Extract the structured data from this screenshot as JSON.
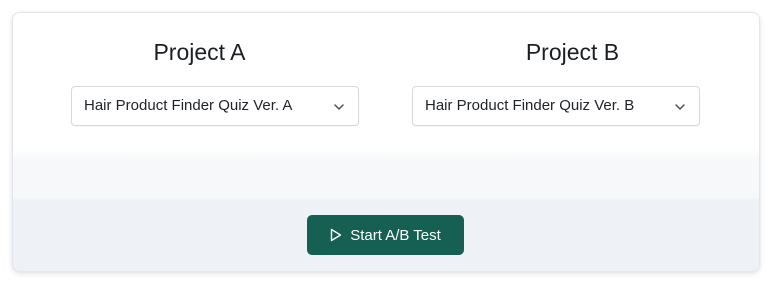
{
  "projects": [
    {
      "title": "Project A",
      "selected_quiz": "Hair Product Finder Quiz Ver. A"
    },
    {
      "title": "Project B",
      "selected_quiz": "Hair Product Finder Quiz Ver. B"
    }
  ],
  "actions": {
    "start_label": "Start A/B Test",
    "start_icon": "play-icon",
    "accent_color": "#165f53"
  },
  "icons": {
    "dropdown": "chevron-down-icon"
  }
}
